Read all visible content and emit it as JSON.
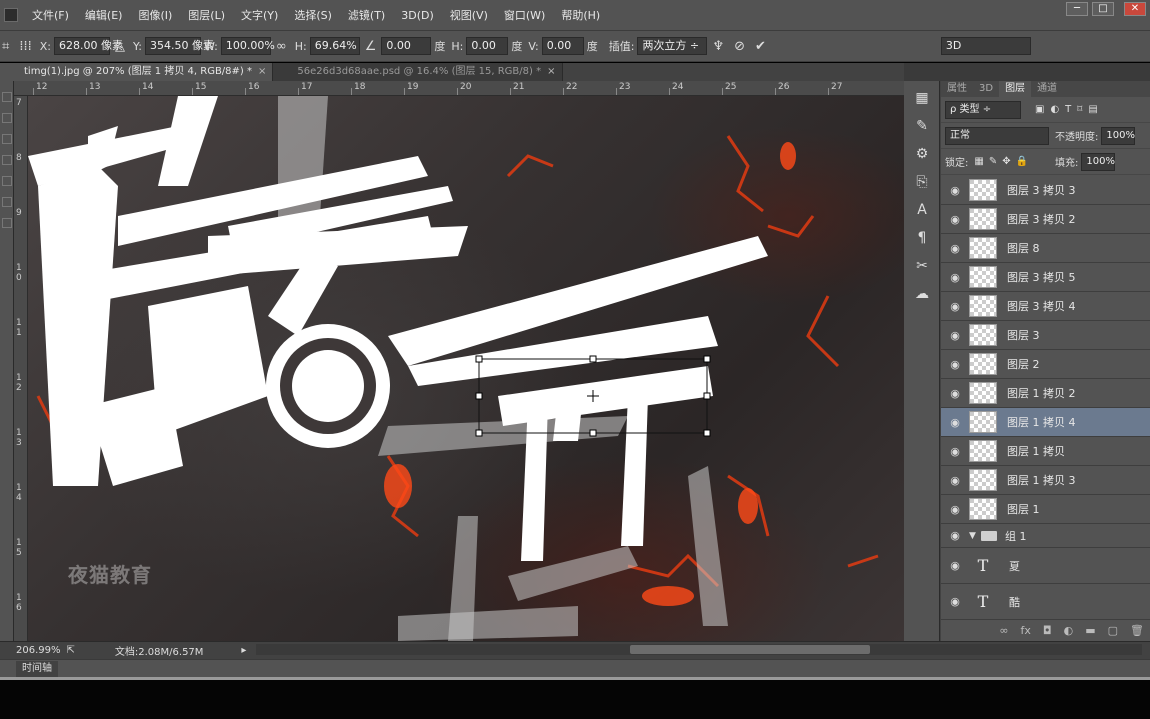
{
  "menubar": {
    "items": [
      "文件(F)",
      "编辑(E)",
      "图像(I)",
      "图层(L)",
      "文字(Y)",
      "选择(S)",
      "滤镜(T)",
      "3D(D)",
      "视图(V)",
      "窗口(W)",
      "帮助(H)"
    ],
    "window_controls": [
      "─",
      "□",
      "✕"
    ]
  },
  "options": {
    "x_label": "X:",
    "x_value": "628.00 像素",
    "y_label": "Y:",
    "y_value": "354.50 像素",
    "w_label": "W:",
    "w_value": "100.00%",
    "h_label": "H:",
    "h_value": "69.64%",
    "angle_value": "0.00",
    "degree": "度",
    "hskew_label": "H:",
    "hskew_value": "0.00",
    "vskew_label": "V:",
    "vskew_value": "0.00",
    "interp_label": "插值:",
    "interp_value": "两次立方 ÷",
    "workspace": "3D"
  },
  "tabs": [
    {
      "label": "timg(1).jpg @ 207% (图层 1 拷贝 4, RGB/8#) *",
      "close": "×"
    },
    {
      "label": "56e26d3d68aae.psd @ 16.4% (图层 15, RGB/8) *",
      "close": "×"
    }
  ],
  "ruler": {
    "top": [
      "12",
      "13",
      "14",
      "15",
      "16",
      "17",
      "18",
      "19",
      "20",
      "21",
      "22",
      "23",
      "24",
      "25",
      "26",
      "27"
    ],
    "left": [
      "7",
      "8",
      "9",
      "1 0",
      "1 1",
      "1 2",
      "1 3",
      "1 4",
      "1 5",
      "1 6"
    ]
  },
  "canvas": {
    "watermark": "夜猫教育",
    "colors": {
      "lava": "#e23b12",
      "rock": "#3a3434"
    }
  },
  "panel": {
    "tabs": [
      "属性",
      "3D",
      "图层",
      "通道"
    ],
    "kind_filter": "ρ 类型 ÷",
    "blend_mode": "正常",
    "opacity_label": "不透明度:",
    "opacity_value": "100%",
    "lock_label": "锁定:",
    "fill_label": "填充:",
    "fill_value": "100%",
    "layers": [
      {
        "name": "图层 3 拷贝 3",
        "type": "pixel",
        "selected": false
      },
      {
        "name": "图层 3 拷贝 2",
        "type": "pixel",
        "selected": false
      },
      {
        "name": "图层 8",
        "type": "pixel",
        "selected": false
      },
      {
        "name": "图层 3 拷贝 5",
        "type": "pixel",
        "selected": false
      },
      {
        "name": "图层 3 拷贝 4",
        "type": "pixel",
        "selected": false
      },
      {
        "name": "图层 3",
        "type": "pixel",
        "selected": false
      },
      {
        "name": "图层 2",
        "type": "pixel",
        "selected": false
      },
      {
        "name": "图层 1 拷贝 2",
        "type": "pixel",
        "selected": false
      },
      {
        "name": "图层 1 拷贝 4",
        "type": "pixel",
        "selected": true
      },
      {
        "name": "图层 1 拷贝",
        "type": "pixel",
        "selected": false
      },
      {
        "name": "图层 1 拷贝 3",
        "type": "pixel",
        "selected": false
      },
      {
        "name": "图层 1",
        "type": "pixel",
        "selected": false
      },
      {
        "name": "组 1",
        "type": "group",
        "selected": false
      },
      {
        "name": "夏",
        "type": "text",
        "selected": false
      },
      {
        "name": "酷",
        "type": "text",
        "selected": false
      }
    ],
    "footer_icons": [
      "link-icon",
      "fx-icon",
      "mask-icon",
      "adjustment-icon",
      "folder-icon",
      "new-layer-icon",
      "trash-icon"
    ]
  },
  "status": {
    "zoom": "206.99%",
    "doc": "文档:2.08M/6.57M"
  },
  "timeline": {
    "label": "时间轴"
  }
}
